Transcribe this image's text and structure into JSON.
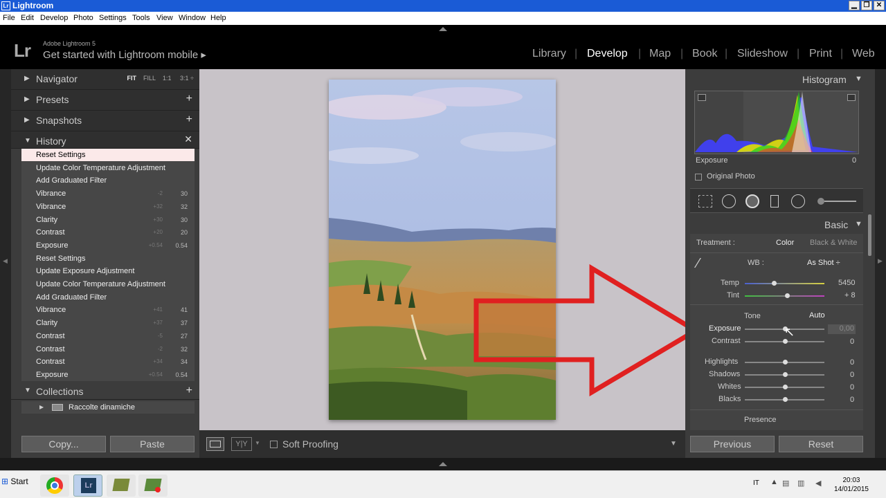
{
  "window": {
    "title": "Lightroom",
    "app_icon": "Lr"
  },
  "menu": [
    "File",
    "Edit",
    "Develop",
    "Photo",
    "Settings",
    "Tools",
    "View",
    "Window",
    "Help"
  ],
  "header": {
    "logo": "Lr",
    "product": "Adobe Lightroom 5",
    "mobile_prompt": "Get started with Lightroom mobile ▸"
  },
  "modules": [
    "Library",
    "Develop",
    "Map",
    "Book",
    "Slideshow",
    "Print",
    "Web"
  ],
  "active_module": "Develop",
  "left": {
    "navigator": {
      "label": "Navigator",
      "opts": [
        "FIT",
        "FILL",
        "1:1",
        "3:1 ÷"
      ]
    },
    "presets": {
      "label": "Presets"
    },
    "snapshots": {
      "label": "Snapshots"
    },
    "history": {
      "label": "History",
      "items": [
        {
          "label": "Reset Settings",
          "before": "",
          "after": ""
        },
        {
          "label": "Update Color Temperature Adjustment",
          "before": "",
          "after": ""
        },
        {
          "label": "Add Graduated Filter",
          "before": "",
          "after": ""
        },
        {
          "label": "Vibrance",
          "before": "-2",
          "after": "30"
        },
        {
          "label": "Vibrance",
          "before": "+32",
          "after": "32"
        },
        {
          "label": "Clarity",
          "before": "+30",
          "after": "30"
        },
        {
          "label": "Contrast",
          "before": "+20",
          "after": "20"
        },
        {
          "label": "Exposure",
          "before": "+0.54",
          "after": "0.54"
        },
        {
          "label": "Reset Settings",
          "before": "",
          "after": ""
        },
        {
          "label": "Update Exposure Adjustment",
          "before": "",
          "after": ""
        },
        {
          "label": "Update Color Temperature Adjustment",
          "before": "",
          "after": ""
        },
        {
          "label": "Add Graduated Filter",
          "before": "",
          "after": ""
        },
        {
          "label": "Vibrance",
          "before": "+41",
          "after": "41"
        },
        {
          "label": "Clarity",
          "before": "+37",
          "after": "37"
        },
        {
          "label": "Contrast",
          "before": "-5",
          "after": "27"
        },
        {
          "label": "Contrast",
          "before": "-2",
          "after": "32"
        },
        {
          "label": "Contrast",
          "before": "+34",
          "after": "34"
        },
        {
          "label": "Exposure",
          "before": "+0.54",
          "after": "0.54"
        }
      ]
    },
    "collections": {
      "label": "Collections",
      "item": "Raccolte dinamiche"
    },
    "copy_label": "Copy...",
    "paste_label": "Paste"
  },
  "toolbar": {
    "soft_proofing": "Soft Proofing",
    "yy": "Y|Y"
  },
  "right": {
    "histogram": {
      "label": "Histogram",
      "exposure_label": "Exposure",
      "exposure_value": "0",
      "original_photo": "Original Photo"
    },
    "basic": {
      "label": "Basic",
      "treatment_label": "Treatment :",
      "color": "Color",
      "bw": "Black & White",
      "wb_label": "WB :",
      "wb_value": "As Shot ÷",
      "temp_label": "Temp",
      "temp_value": "5450",
      "tint_label": "Tint",
      "tint_value": "+ 8",
      "tone_label": "Tone",
      "auto_label": "Auto",
      "exposure_label": "Exposure",
      "exposure_value": "0,00",
      "contrast_label": "Contrast",
      "contrast_value": "0",
      "highlights_label": "Highlights",
      "highlights_value": "0",
      "shadows_label": "Shadows",
      "shadows_value": "0",
      "whites_label": "Whites",
      "whites_value": "0",
      "blacks_label": "Blacks",
      "blacks_value": "0",
      "presence_label": "Presence"
    },
    "previous_label": "Previous",
    "reset_label": "Reset"
  },
  "taskbar": {
    "start": "Start",
    "lang": "IT",
    "time": "20:03",
    "date": "14/01/2015"
  }
}
